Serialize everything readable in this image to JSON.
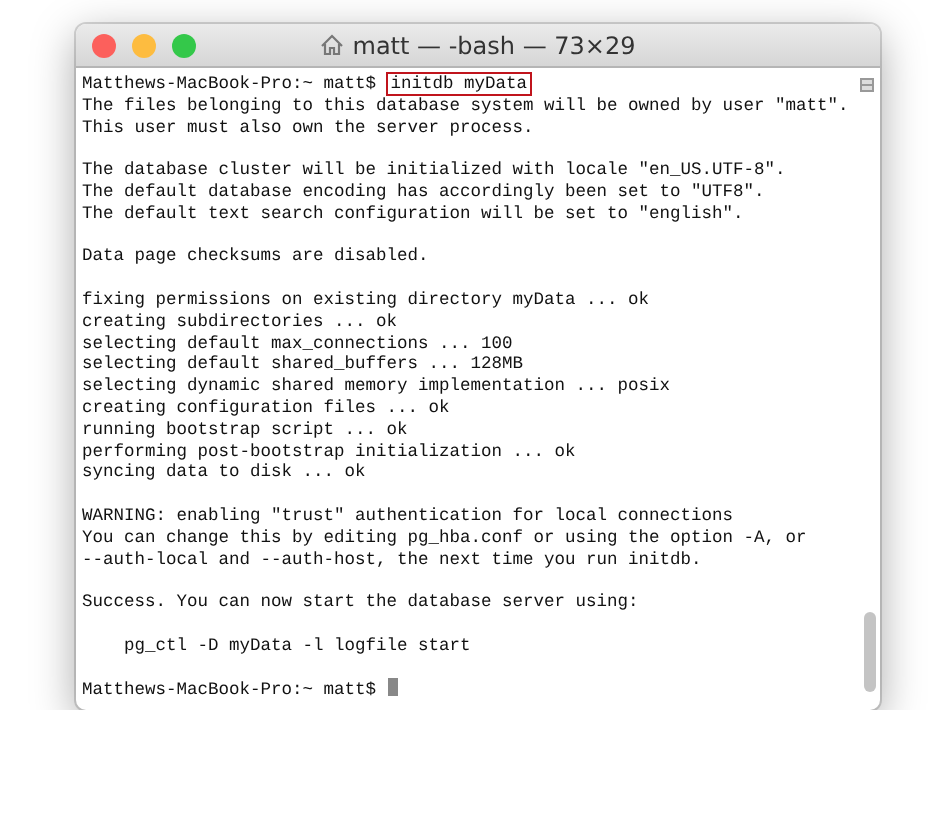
{
  "window": {
    "title": "matt — -bash — 73×29"
  },
  "lines": [
    {
      "kind": "prompt",
      "prompt": "Matthews-MacBook-Pro:~ matt$",
      "command": "initdb myData",
      "highlighted": true,
      "cursor": false
    },
    {
      "kind": "output",
      "text": "The files belonging to this database system will be owned by user \"matt\"."
    },
    {
      "kind": "output",
      "text": "This user must also own the server process."
    },
    {
      "kind": "blank"
    },
    {
      "kind": "output",
      "text": "The database cluster will be initialized with locale \"en_US.UTF-8\"."
    },
    {
      "kind": "output",
      "text": "The default database encoding has accordingly been set to \"UTF8\"."
    },
    {
      "kind": "output",
      "text": "The default text search configuration will be set to \"english\"."
    },
    {
      "kind": "blank"
    },
    {
      "kind": "output",
      "text": "Data page checksums are disabled."
    },
    {
      "kind": "blank"
    },
    {
      "kind": "output",
      "text": "fixing permissions on existing directory myData ... ok"
    },
    {
      "kind": "output",
      "text": "creating subdirectories ... ok"
    },
    {
      "kind": "output",
      "text": "selecting default max_connections ... 100"
    },
    {
      "kind": "output",
      "text": "selecting default shared_buffers ... 128MB"
    },
    {
      "kind": "output",
      "text": "selecting dynamic shared memory implementation ... posix"
    },
    {
      "kind": "output",
      "text": "creating configuration files ... ok"
    },
    {
      "kind": "output",
      "text": "running bootstrap script ... ok"
    },
    {
      "kind": "output",
      "text": "performing post-bootstrap initialization ... ok"
    },
    {
      "kind": "output",
      "text": "syncing data to disk ... ok"
    },
    {
      "kind": "blank"
    },
    {
      "kind": "output",
      "text": "WARNING: enabling \"trust\" authentication for local connections"
    },
    {
      "kind": "output",
      "text": "You can change this by editing pg_hba.conf or using the option -A, or"
    },
    {
      "kind": "output",
      "text": "--auth-local and --auth-host, the next time you run initdb."
    },
    {
      "kind": "blank"
    },
    {
      "kind": "output",
      "text": "Success. You can now start the database server using:"
    },
    {
      "kind": "blank"
    },
    {
      "kind": "output",
      "text": "    pg_ctl -D myData -l logfile start"
    },
    {
      "kind": "blank"
    },
    {
      "kind": "prompt",
      "prompt": "Matthews-MacBook-Pro:~ matt$",
      "highlighted": false,
      "cursor": true
    }
  ]
}
